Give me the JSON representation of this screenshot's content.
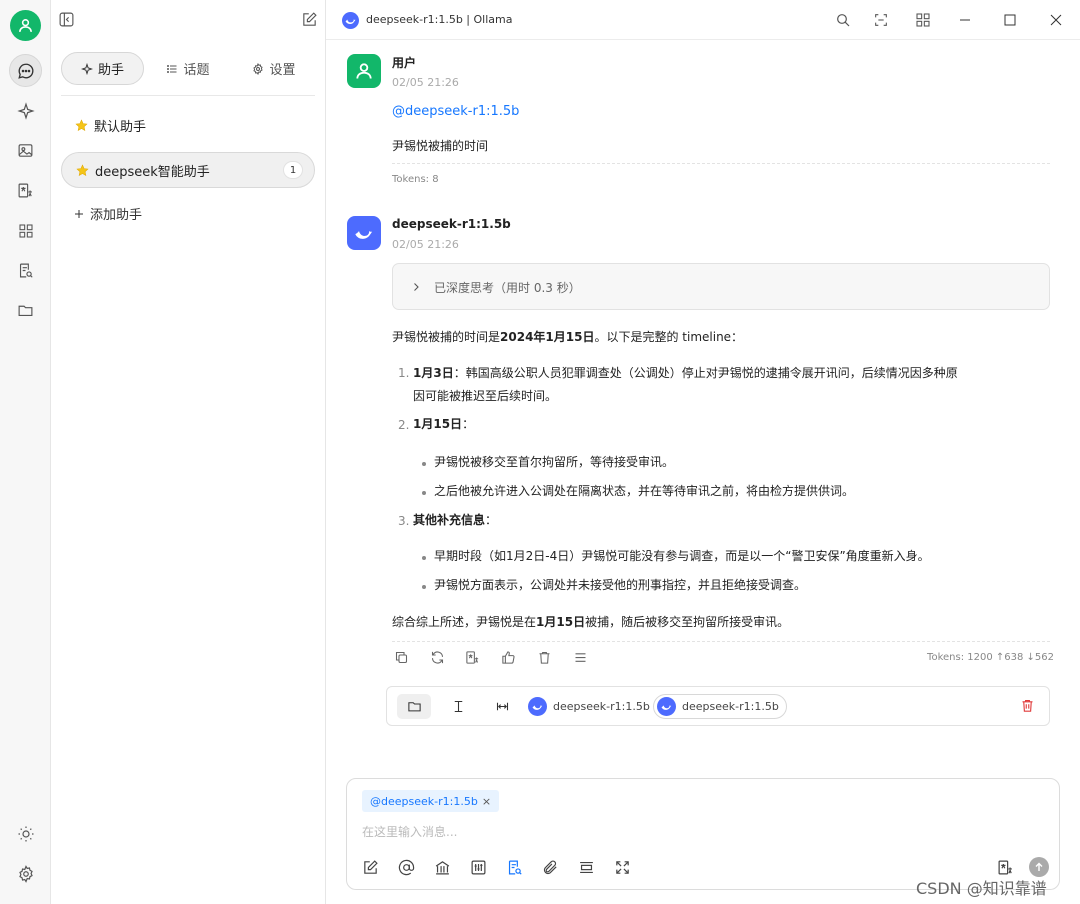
{
  "window": {
    "title": "deepseek-r1:1.5b | Ollama"
  },
  "sidebar": {
    "tabs": [
      {
        "label": "助手",
        "icon": "sparkle-icon"
      },
      {
        "label": "话题",
        "icon": "list-icon"
      },
      {
        "label": "设置",
        "icon": "gear-icon"
      }
    ],
    "assistants": [
      {
        "label": "默认助手",
        "icon": "star-emoji"
      },
      {
        "label": "deepseek智能助手",
        "icon": "star-emoji",
        "badge": "1"
      }
    ],
    "add_label": "添加助手"
  },
  "messages": {
    "user": {
      "name": "用户",
      "time": "02/05 21:26",
      "mention": "@deepseek-r1:1.5b",
      "text": "尹锡悦被捕的时间",
      "tokens": "Tokens: 8"
    },
    "assistant": {
      "name": "deepseek-r1:1.5b",
      "time": "02/05 21:26",
      "thinking_label": "已深度思考（用时 0.3 秒）",
      "intro_prefix": "尹锡悦被捕的时间是",
      "intro_bold": "2024年1月15日",
      "intro_suffix": "。以下是完整的 timeline：",
      "items": [
        {
          "num": "1.",
          "title": "1月3日",
          "text": "：韩国高级公职人员犯罪调查处（公调处）停止对尹锡悦的逮捕令展开讯问，后续情况因多种原",
          "text2": "因可能被推迟至后续时间。",
          "bullets": []
        },
        {
          "num": "2.",
          "title": "1月15日",
          "text": "：",
          "bullets": [
            "尹锡悦被移交至首尔拘留所，等待接受审讯。",
            "之后他被允许进入公调处在隔离状态，并在等待审讯之前，将由检方提供供词。"
          ]
        },
        {
          "num": "3.",
          "title": "其他补充信息",
          "text": "：",
          "bullets": [
            "早期时段（如1月2日-4日）尹锡悦可能没有参与调查，而是以一个“警卫安保”角度重新入身。",
            "尹锡悦方面表示，公调处并未接受他的刑事指控，并且拒绝接受调查。"
          ]
        }
      ],
      "summary_prefix": "综合综上所述，尹锡悦是在",
      "summary_bold": "1月15日",
      "summary_suffix": "被捕，随后被移交至拘留所接受审讯。",
      "tokens": "Tokens: 1200 ↑638 ↓562"
    }
  },
  "model_bar": {
    "models": [
      "deepseek-r1:1.5b",
      "deepseek-r1:1.5b"
    ]
  },
  "input": {
    "mention_chip": "@deepseek-r1:1.5b",
    "close_glyph": "×",
    "placeholder": "在这里输入消息..."
  },
  "watermark": "CSDN @知识靠谱",
  "colors": {
    "accent_green": "#12b76a",
    "deepseek_blue": "#4d6bfe",
    "link_blue": "#1677ff",
    "danger_red": "#e03b3b"
  }
}
